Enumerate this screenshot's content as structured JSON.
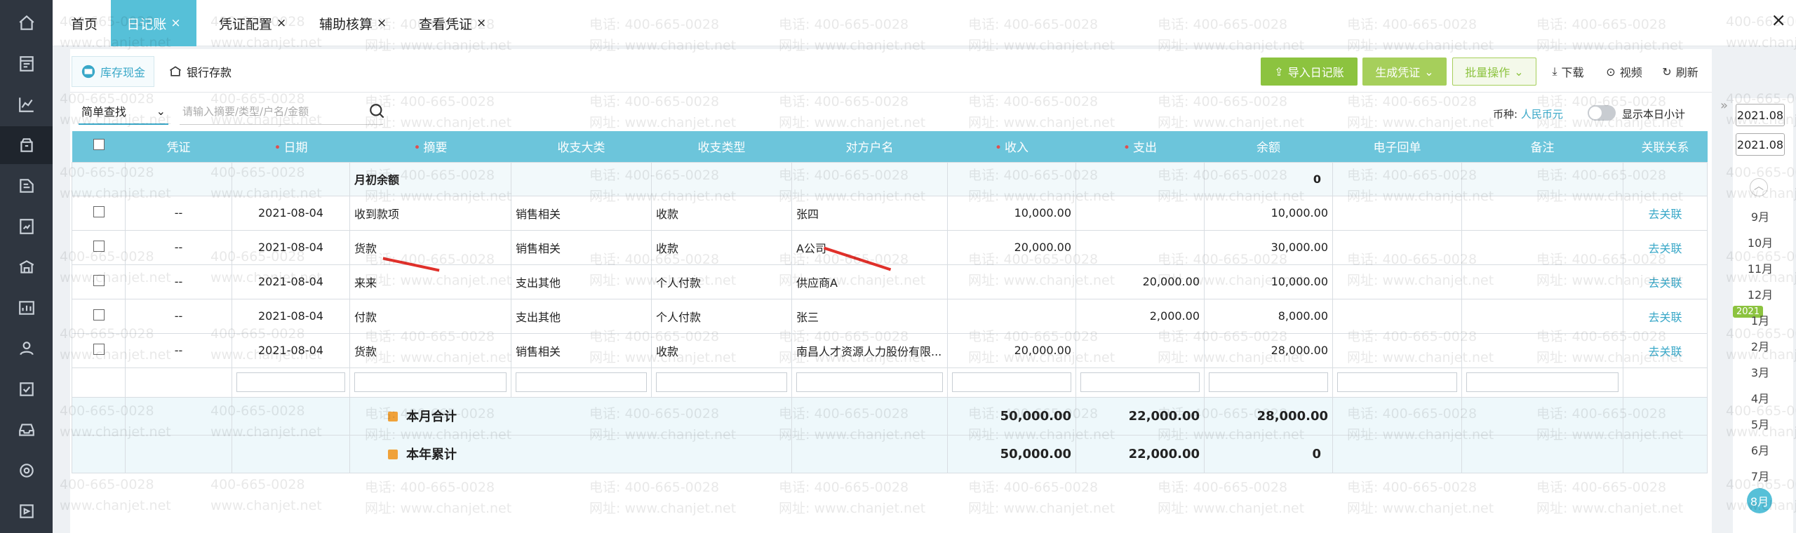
{
  "tabs": [
    {
      "label": "首页",
      "closable": false
    },
    {
      "label": "日记账",
      "closable": true
    },
    {
      "label": "凭证配置",
      "closable": true
    },
    {
      "label": "辅助核算",
      "closable": true
    },
    {
      "label": "查看凭证",
      "closable": true
    }
  ],
  "close_icon": "×",
  "subtabs": {
    "cash": "库存现金",
    "bank": "银行存款"
  },
  "toolbar": {
    "import": "导入日记账",
    "generate": "生成凭证",
    "batch": "批量操作",
    "download": "下载",
    "video": "视频",
    "refresh": "刷新"
  },
  "search": {
    "mode": "简单查找",
    "placeholder": "请输入摘要/类型/户名/金额"
  },
  "currency": {
    "label": "币种:",
    "value": "人民币元"
  },
  "show_subtotal": "显示本日小计",
  "columns": [
    "凭证",
    "日期",
    "摘要",
    "收支大类",
    "收支类型",
    "对方户名",
    "收入",
    "支出",
    "余额",
    "电子回单",
    "备注",
    "关联关系"
  ],
  "opening": {
    "label": "月初余额",
    "balance": "0"
  },
  "rows": [
    {
      "voucher": "--",
      "date": "2021-08-04",
      "summary": "收到款项",
      "category": "销售相关",
      "type": "收款",
      "party": "张四",
      "income": "10,000.00",
      "expense": "",
      "balance": "10,000.00",
      "action": "去关联"
    },
    {
      "voucher": "--",
      "date": "2021-08-04",
      "summary": "货款",
      "category": "销售相关",
      "type": "收款",
      "party": "A公司",
      "income": "20,000.00",
      "expense": "",
      "balance": "30,000.00",
      "action": "去关联"
    },
    {
      "voucher": "--",
      "date": "2021-08-04",
      "summary": "来来",
      "category": "支出其他",
      "type": "个人付款",
      "party": "供应商A",
      "income": "",
      "expense": "20,000.00",
      "balance": "10,000.00",
      "action": "去关联"
    },
    {
      "voucher": "--",
      "date": "2021-08-04",
      "summary": "付款",
      "category": "支出其他",
      "type": "个人付款",
      "party": "张三",
      "income": "",
      "expense": "2,000.00",
      "balance": "8,000.00",
      "action": "去关联"
    },
    {
      "voucher": "--",
      "date": "2021-08-04",
      "summary": "货款",
      "category": "销售相关",
      "type": "收款",
      "party": "南昌人才资源人力股份有限...",
      "income": "20,000.00",
      "expense": "",
      "balance": "28,000.00",
      "action": "去关联"
    }
  ],
  "month_total": {
    "label": "本月合计",
    "income": "50,000.00",
    "expense": "22,000.00",
    "balance": "28,000.00"
  },
  "year_total": {
    "label": "本年累计",
    "income": "50,000.00",
    "expense": "22,000.00",
    "balance": "0"
  },
  "calendar": {
    "years": [
      "2021.08",
      "2021.08"
    ],
    "months": [
      "9月",
      "10月",
      "11月",
      "12月",
      "1月",
      "2月",
      "3月",
      "4月",
      "5月",
      "6月",
      "7月"
    ],
    "badge": "2021",
    "current": "8月"
  },
  "watermark": {
    "phone": "电话: 400-665-0028",
    "site": "网址: www.chanjet.net",
    "phone_short": "400-665-0028",
    "site_short": "www.chanjet.net"
  },
  "colors": {
    "accent": "#56c0d8",
    "green": "#8cc33f",
    "header": "#6cc5db",
    "arrow": "#e0302a"
  }
}
